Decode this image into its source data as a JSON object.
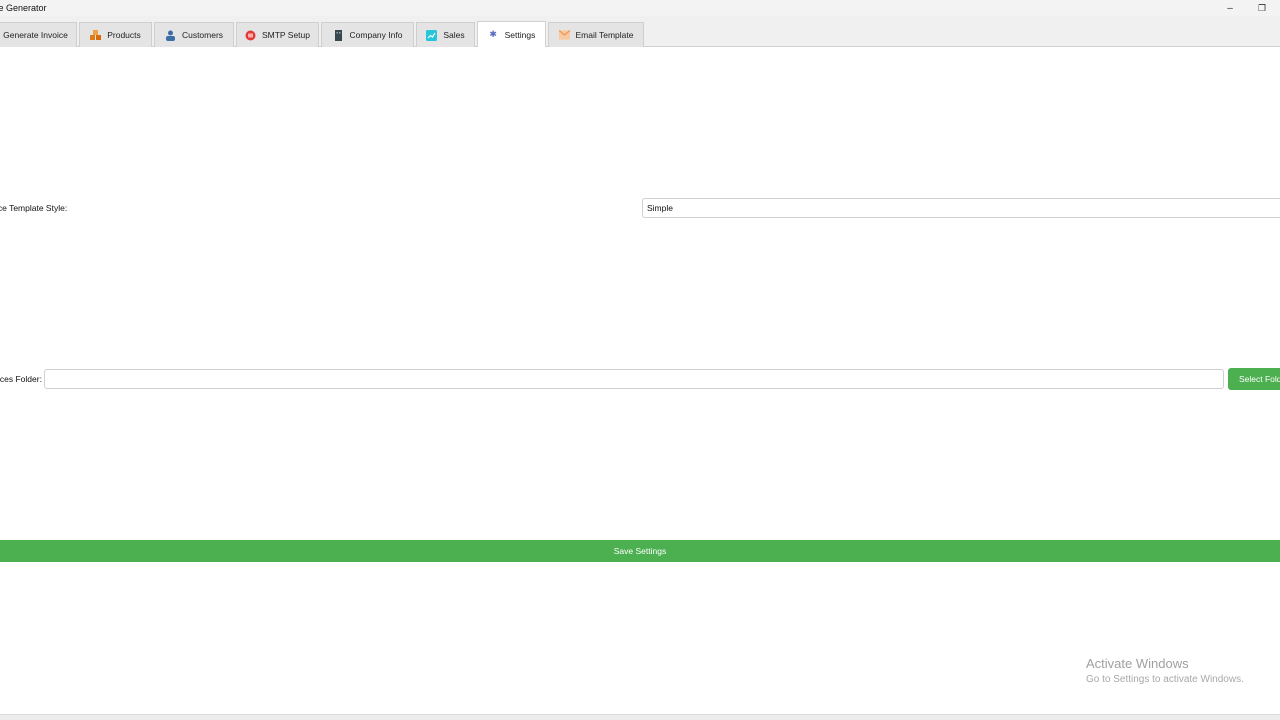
{
  "window": {
    "title": "ice Generator",
    "minimize_glyph": "–",
    "restore_glyph": "❐"
  },
  "tabs": [
    {
      "label": "Generate Invoice",
      "icon": "none",
      "active": false
    },
    {
      "label": "Products",
      "icon": "boxes-icon",
      "icon_color": "#e07b1a",
      "active": false
    },
    {
      "label": "Customers",
      "icon": "person-icon",
      "icon_color": "#3a6ea5",
      "active": false
    },
    {
      "label": "SMTP Setup",
      "icon": "server-icon",
      "icon_color": "#e53935",
      "active": false
    },
    {
      "label": "Company Info",
      "icon": "building-icon",
      "icon_color": "#37474f",
      "active": false
    },
    {
      "label": "Sales",
      "icon": "chart-icon",
      "icon_color": "#26c6da",
      "active": false
    },
    {
      "label": "Settings",
      "icon": "gear-icon",
      "icon_color": "#5c6bc0",
      "active": true
    },
    {
      "label": "Email Template",
      "icon": "mail-icon",
      "icon_color": "#ef8f4f",
      "active": false
    }
  ],
  "settings": {
    "template_style_label": "ice Template Style:",
    "template_style_value": "Simple",
    "invoices_folder_label": "ices Folder:",
    "invoices_folder_value": "",
    "select_folder_button": "Select Fold",
    "save_button": "Save Settings"
  },
  "watermark": {
    "title": "Activate Windows",
    "subtitle": "Go to Settings to activate Windows."
  },
  "colors": {
    "accent_green": "#4caf50"
  }
}
